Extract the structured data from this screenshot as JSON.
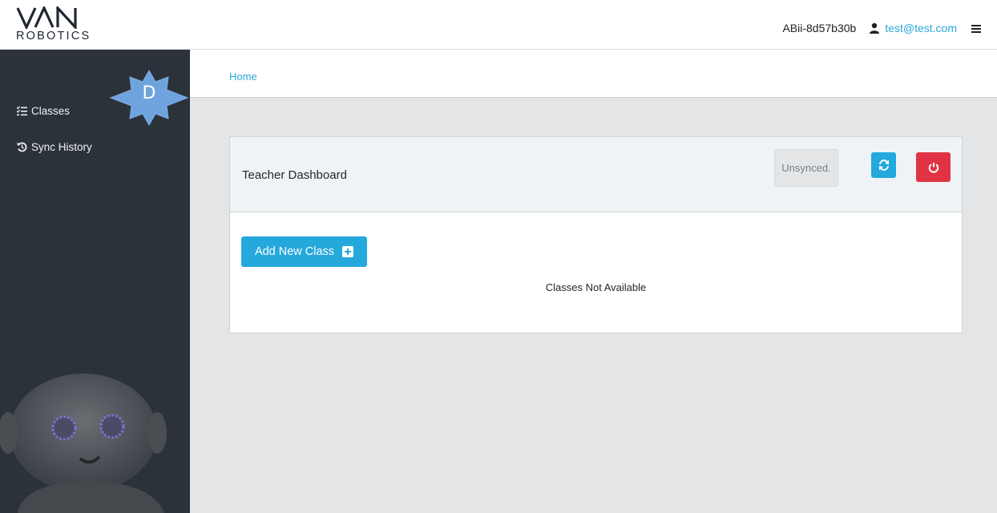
{
  "brand": {
    "logo_icon": "van-logo",
    "subtitle": "ROBOTICS"
  },
  "header": {
    "device_id": "ABii-8d57b30b",
    "user_icon": "user-icon",
    "user_email": "test@test.com",
    "menu_icon": "hamburger-menu-icon"
  },
  "sidebar": {
    "items": [
      {
        "label": "Classes",
        "icon": "list-check-icon"
      },
      {
        "label": "Sync History",
        "icon": "history-icon"
      }
    ]
  },
  "badge": {
    "letter": "D"
  },
  "breadcrumb": {
    "home": "Home"
  },
  "dashboard": {
    "title": "Teacher Dashboard",
    "sync_status": "Unsynced.",
    "sync_icon": "sync-icon",
    "power_icon": "power-icon",
    "add_class_label": "Add New Class",
    "add_icon": "plus-square-icon",
    "empty_message": "Classes Not Available"
  },
  "colors": {
    "accent": "#23a9de",
    "danger": "#e03444",
    "sidebar_bg": "#2c323a",
    "main_bg": "#e4e5e6"
  }
}
